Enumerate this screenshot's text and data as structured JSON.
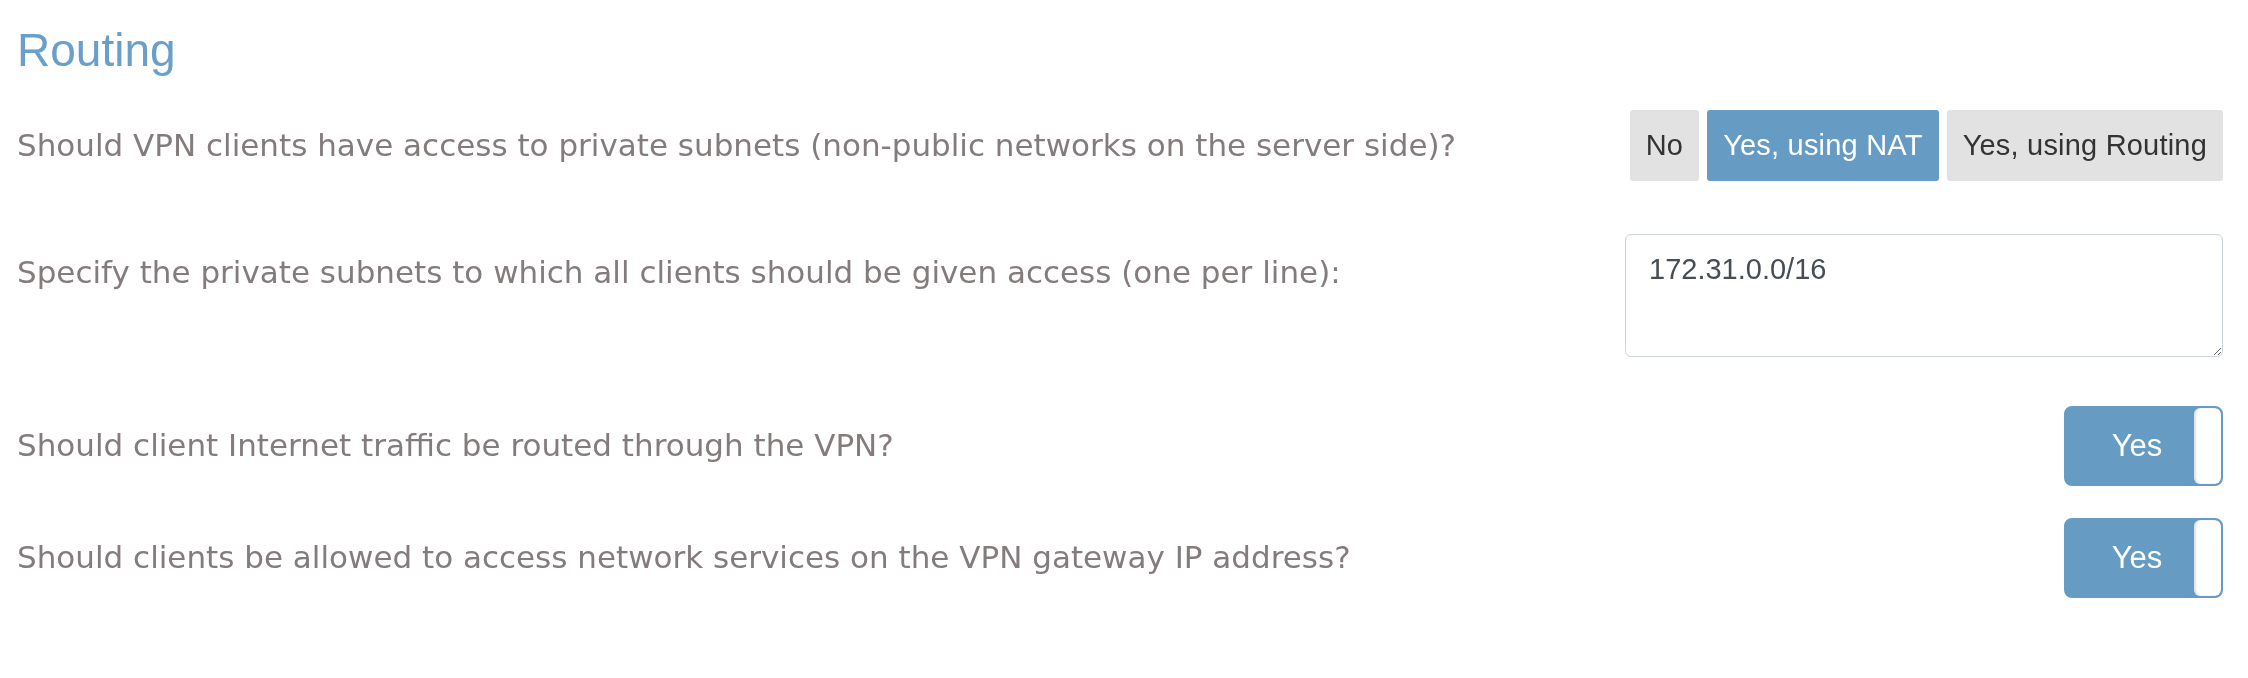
{
  "section": {
    "title": "Routing"
  },
  "settings": [
    {
      "kind": "choice",
      "label": "Should VPN clients have access to private subnets (non-public networks on the server side)?",
      "options": [
        {
          "label": "No",
          "selected": false
        },
        {
          "label": "Yes, using NAT",
          "selected": true
        },
        {
          "label": "Yes, using Routing",
          "selected": false
        }
      ]
    },
    {
      "kind": "textarea",
      "label": "Specify the private subnets to which all clients should be given access (one per line):",
      "value": "172.31.0.0/16"
    },
    {
      "kind": "toggle",
      "label": "Should client Internet traffic be routed through the VPN?",
      "on": true,
      "state_label": "Yes"
    },
    {
      "kind": "toggle",
      "label": "Should clients be allowed to access network services on the VPN gateway IP address?",
      "on": true,
      "state_label": "Yes"
    }
  ]
}
